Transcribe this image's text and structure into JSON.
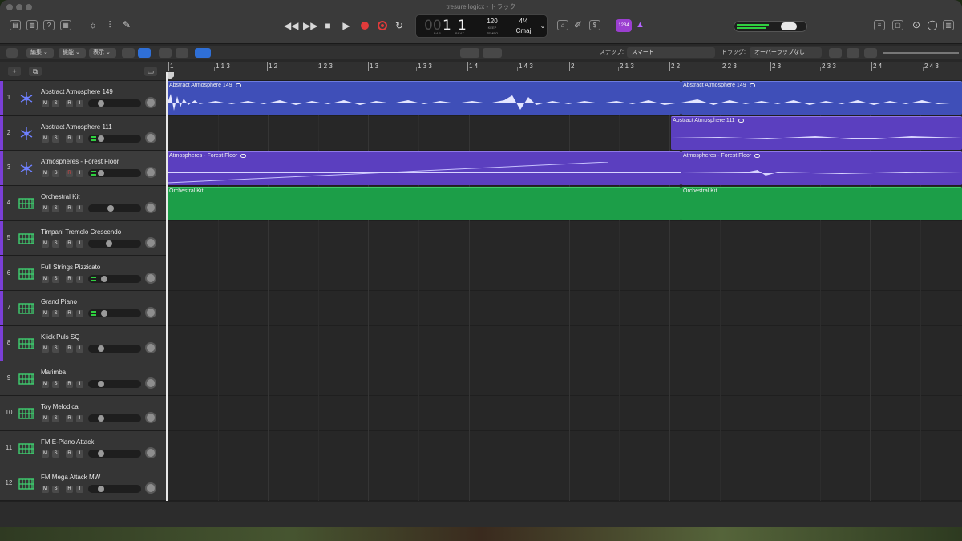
{
  "window": {
    "title": "tresure.logicx - トラック"
  },
  "toolbar": {
    "transport": {
      "rewind": "◀◀",
      "forward": "▶▶",
      "stop": "■",
      "play": "▶",
      "cycle": "↻"
    },
    "lcd": {
      "bar": "1",
      "beat": "1",
      "bar_dim": "00",
      "bar_label": "BAR",
      "beat_label": "BEAT",
      "tempo": "120",
      "keep": "KEEP",
      "tempo_label": "TEMPO",
      "signature": "4/4",
      "key": "Cmaj"
    },
    "count_in_badge": "1234"
  },
  "editbar": {
    "menus": [
      "編集",
      "機能",
      "表示"
    ],
    "snap_label": "スナップ:",
    "snap_value": "スマート",
    "drag_label": "ドラッグ:",
    "drag_value": "オーバーラップなし"
  },
  "ruler": {
    "labels": [
      "1",
      "1 1 3",
      "1 2",
      "1 2 3",
      "1 3",
      "1 3 3",
      "1 4",
      "1 4 3",
      "2",
      "2 1 3",
      "2 2",
      "2 2 3",
      "2 3",
      "2 3 3",
      "2 4",
      "2 4 3"
    ]
  },
  "tracks": [
    {
      "num": "1",
      "name": "Abstract Atmosphere 149",
      "type": "audio",
      "color": "#7a3fd6",
      "rec_active": false,
      "level": false
    },
    {
      "num": "2",
      "name": "Abstract Atmosphere 111",
      "type": "audio",
      "color": "#7a3fd6",
      "rec_active": false,
      "level": true
    },
    {
      "num": "3",
      "name": "Atmospheres - Forest Floor",
      "type": "audio",
      "color": "#7a3fd6",
      "rec_active": true,
      "level": true
    },
    {
      "num": "4",
      "name": "Orchestral Kit",
      "type": "instrument",
      "color": "#7a3fd6",
      "rec_active": false,
      "level": false
    },
    {
      "num": "5",
      "name": "Timpani Tremolo Crescendo",
      "type": "instrument",
      "color": "#7a3fd6",
      "rec_active": false,
      "level": false
    },
    {
      "num": "6",
      "name": "Full Strings Pizzicato",
      "type": "instrument",
      "color": "#7a3fd6",
      "rec_active": false,
      "level": true
    },
    {
      "num": "7",
      "name": "Grand Piano",
      "type": "instrument",
      "color": "#7a3fd6",
      "rec_active": false,
      "level": true
    },
    {
      "num": "8",
      "name": "Klick Puls SQ",
      "type": "instrument",
      "color": "#7a3fd6",
      "rec_active": false,
      "level": false
    },
    {
      "num": "9",
      "name": "Marimba",
      "type": "instrument",
      "color": "#353535",
      "rec_active": false,
      "level": false
    },
    {
      "num": "10",
      "name": "Toy Melodica",
      "type": "instrument",
      "color": "#353535",
      "rec_active": false,
      "level": false
    },
    {
      "num": "11",
      "name": "FM E-Piano Attack",
      "type": "instrument",
      "color": "#353535",
      "rec_active": false,
      "level": false
    },
    {
      "num": "12",
      "name": "FM Mega Attack MW",
      "type": "instrument",
      "color": "#353535",
      "rec_active": false,
      "level": false
    }
  ],
  "track_buttons": {
    "mute": "M",
    "solo": "S",
    "rec": "R",
    "input": "I"
  },
  "regions": {
    "r1a": "Abstract Atmosphere 149",
    "r1b": "Abstract Atmosphere 149",
    "r2": "Abstract Atmosphere 111",
    "r3a": "Atmospheres - Forest Floor",
    "r3b": "Atmospheres - Forest Floor",
    "r4a": "Orchestral Kit",
    "r4b": "Orchestral Kit"
  },
  "colors": {
    "audio_region": "#3f4fb8",
    "audio_region_alt": "#5b3fbf",
    "midi_region": "#1c9e48",
    "record": "#e23b3b",
    "accent": "#2f6fd6"
  }
}
